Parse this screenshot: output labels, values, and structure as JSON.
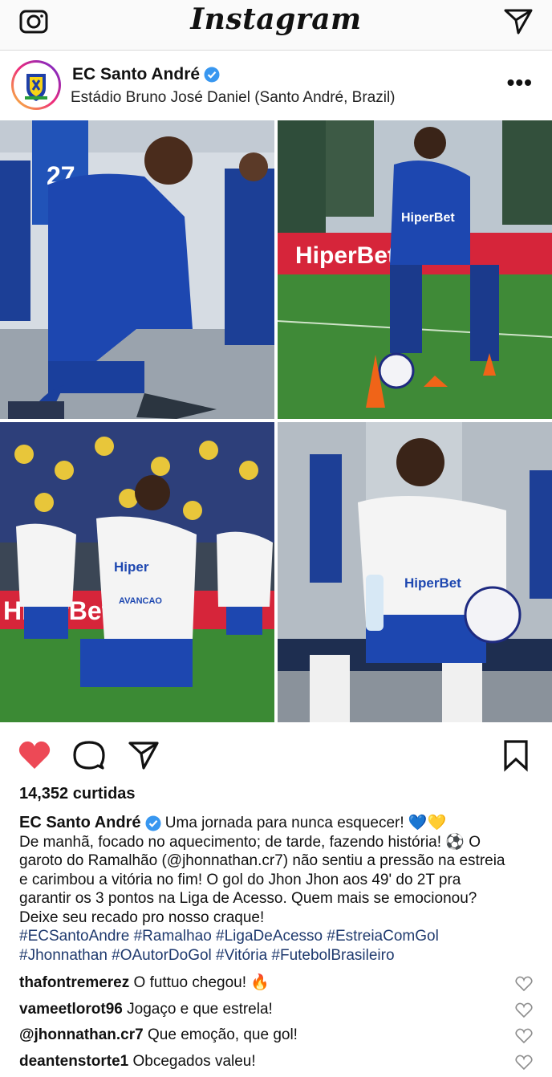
{
  "app": {
    "title": "Instagram"
  },
  "post": {
    "username": "EC Santo André",
    "location": "Estádio Bruno José Daniel (Santo André, Brazil)",
    "likes": "14,352 curtidas",
    "caption": {
      "username": "EC Santo André",
      "line1": " Uma jornada para nunca esquecer! 💙💛",
      "body": "De manhã, focado no aquecimento; de tarde, fazendo história! ⚽ O garoto do Ramalhão (@jhonnathan.cr7) não sentiu a pressão na estreia e carimbou a vitória no fim! O gol do Jhon Jhon aos 49' do 2T pra garantir os 3 pontos na Liga de Acesso. Quem mais se emocionou? Deixe seu recado pro nosso craque!",
      "hashtags": "#ECSantoAndre #Ramalhao #LigaDeAcesso #EstreiaComGol #Jhonnathan #OAutorDoGol #Vitória #FutebolBrasileiro"
    },
    "comments": [
      {
        "user": "thafontremerez",
        "text": "O futtuo chegou! 🔥"
      },
      {
        "user": "vameetlorot96",
        "text": "Jogaço e que estrela!"
      },
      {
        "user": "@jhonnathan.cr7",
        "text": "Que emoção, que gol!"
      },
      {
        "user": "deantenstorte1",
        "text": "Obcegados valeu!"
      }
    ],
    "photos": {
      "jersey_name": "27",
      "sponsor": "HiperBet",
      "board": "HiperBet",
      "sponsor2": "Hiper",
      "board2": "HiperBet",
      "kit_sponsor": "AVANCAO",
      "sponsor4": "HiperBet"
    }
  },
  "colors": {
    "heart_red": "#ed4956",
    "hashtag_blue": "#1f3a6e",
    "verified_blue": "#3897f0",
    "kit_blue": "#1e3fa8"
  },
  "icons": [
    "camera-icon",
    "direct-message-icon",
    "verified-icon",
    "more-options-icon",
    "like-heart-icon",
    "comment-icon",
    "share-icon",
    "bookmark-icon",
    "comment-like-icon"
  ]
}
